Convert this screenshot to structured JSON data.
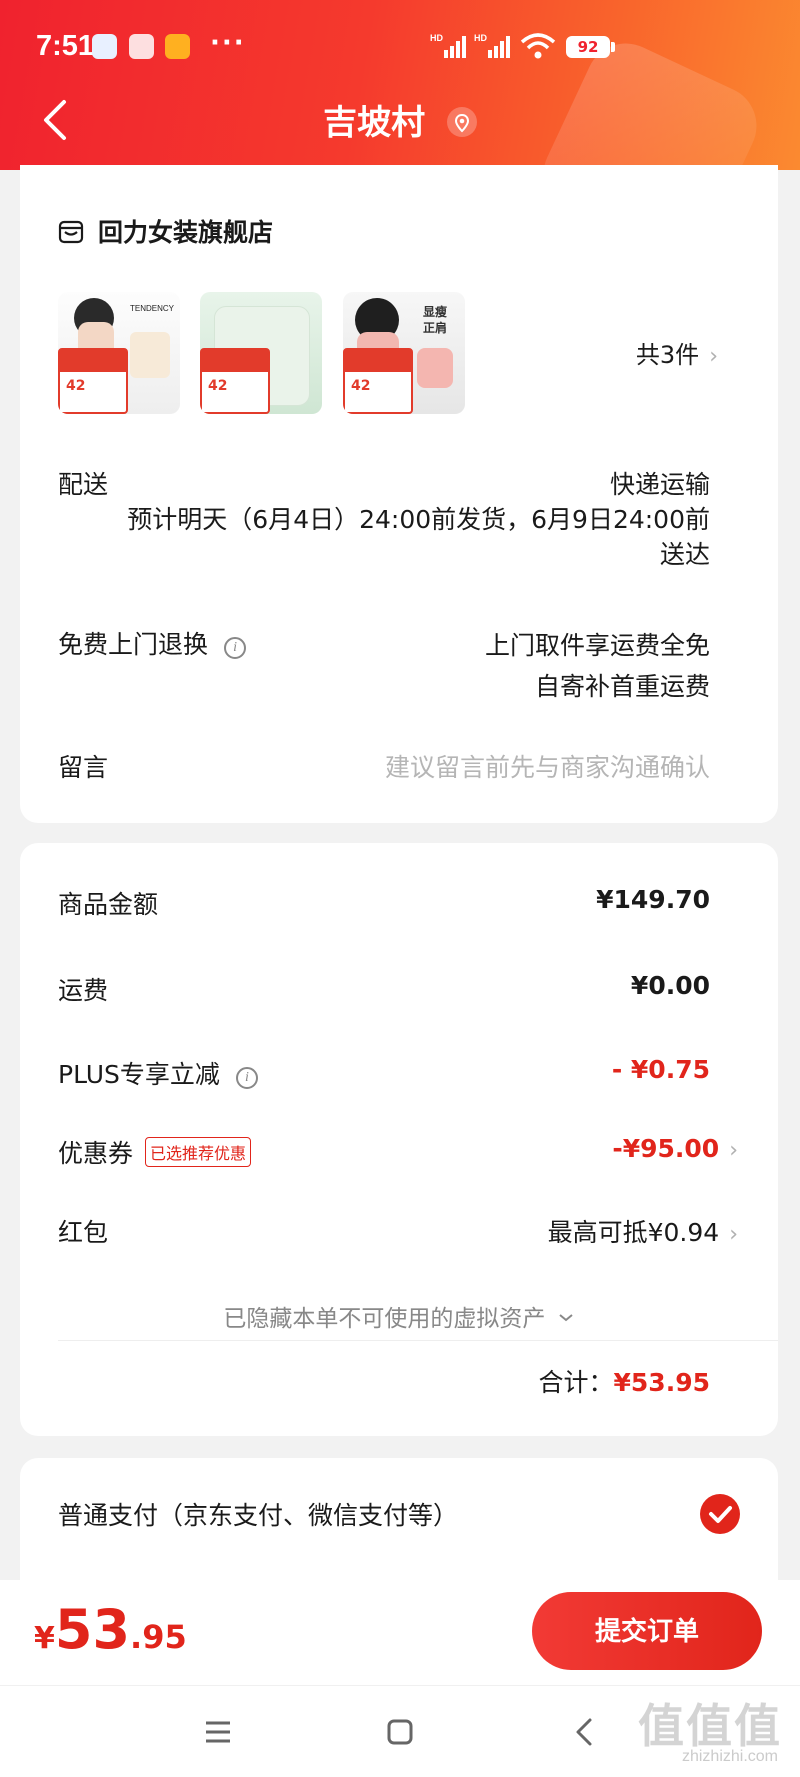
{
  "status_bar": {
    "time": "7:51",
    "dots": "···",
    "battery": "92",
    "network_labels": [
      "HD",
      "HD"
    ]
  },
  "nav": {
    "title": "吉坡村"
  },
  "order_card": {
    "store_name": "回力女装旗舰店",
    "thumb1_brand_text": "TENDENCY",
    "thumb3_text": [
      "显瘦",
      "正肩"
    ],
    "thumb_promo_price": "42",
    "item_count": "共3件",
    "shipping_label": "配送",
    "shipping_method": "快递运输",
    "shipping_detail": "预计明天（6月4日）24:00前发货，6月9日24:00前送达",
    "free_return_label": "免费上门退换",
    "free_return_line1": "上门取件享运费全免",
    "free_return_line2": "自寄补首重运费",
    "message_label": "留言",
    "message_placeholder": "建议留言前先与商家沟通确认"
  },
  "price_card": {
    "goods_amount_label": "商品金额",
    "goods_amount": "¥149.70",
    "shipping_fee_label": "运费",
    "shipping_fee": "¥0.00",
    "plus_label": "PLUS专享立减",
    "plus_discount": "- ¥0.75",
    "coupon_label": "优惠券",
    "coupon_tag": "已选推荐优惠",
    "coupon_value": "-¥95.00",
    "red_packet_label": "红包",
    "red_packet_value": "最高可抵¥0.94",
    "hidden_assets": "已隐藏本单不可使用的虚拟资产",
    "total_label": "合计：",
    "total_value": "¥53.95"
  },
  "payment": {
    "method_label": "普通支付（京东支付、微信支付等）"
  },
  "bottom_bar": {
    "currency": "¥",
    "price_int": "53",
    "price_dec": ".95",
    "submit_label": "提交订单"
  },
  "watermark": {
    "text": "值值值",
    "sub": "zhizhizhi.com"
  },
  "colors": {
    "accent_red": "#e1251b",
    "header_start": "#f0222e",
    "header_end": "#fb8a30"
  }
}
